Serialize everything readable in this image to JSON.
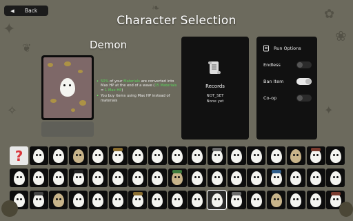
{
  "header": {
    "back_label": "Back",
    "title": "Character Selection"
  },
  "character": {
    "name": "Demon",
    "description": [
      {
        "parts": [
          {
            "text": "50%",
            "color": "green"
          },
          {
            "text": " of your ",
            "color": "white"
          },
          {
            "text": "Materials",
            "color": "green"
          },
          {
            "text": " are converted into ",
            "color": "white"
          },
          {
            "text": "Max HP",
            "color": "white"
          },
          {
            "text": " at the end of a wave (",
            "color": "white"
          },
          {
            "text": "15 Materials",
            "color": "green"
          },
          {
            "text": " = ",
            "color": "white"
          },
          {
            "text": "1 Max HP",
            "color": "green"
          },
          {
            "text": ")",
            "color": "white"
          }
        ]
      },
      {
        "parts": [
          {
            "text": "You buy items using Max HP instead of materials",
            "color": "white"
          }
        ]
      }
    ]
  },
  "records": {
    "title": "Records",
    "line1": "NOT_SET",
    "line2": "None yet"
  },
  "run_options": {
    "title": "Run Options",
    "options": [
      {
        "label": "Endless",
        "on": false
      },
      {
        "label": "Ban Item",
        "on": true
      },
      {
        "label": "Co-op",
        "on": false
      }
    ]
  },
  "roster": {
    "rows": 3,
    "cols": 17,
    "selected_index": 44,
    "random_index": 0
  },
  "colors": {
    "background": "#6c6a5d",
    "panel": "#111111",
    "accent_green": "#5bd75b",
    "random_mark": "#d9353b"
  }
}
